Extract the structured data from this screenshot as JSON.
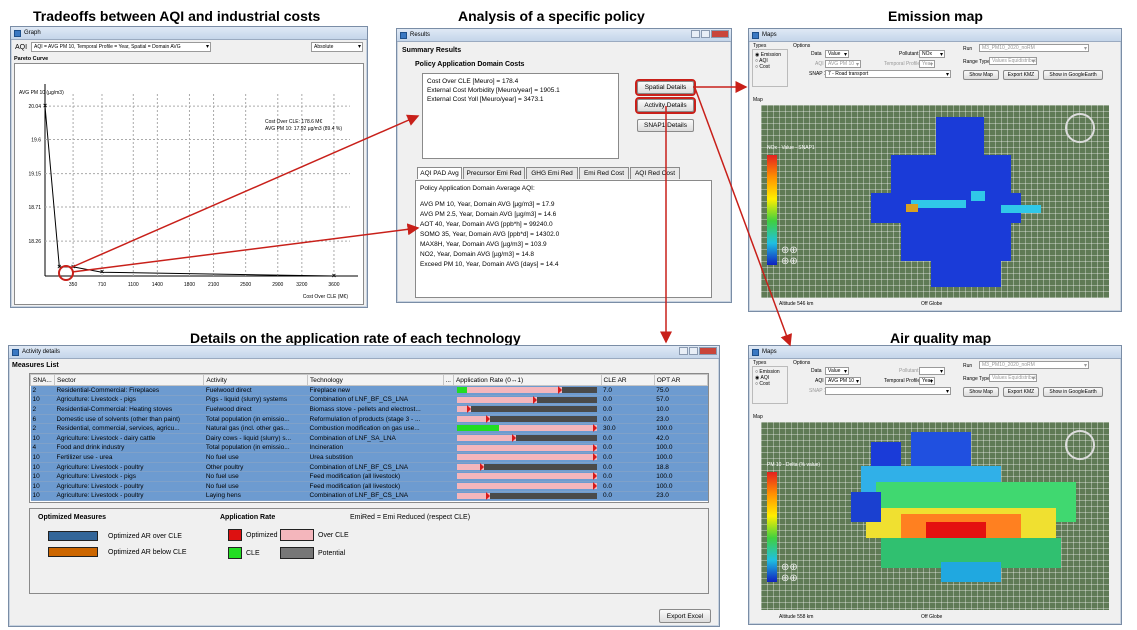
{
  "captions": {
    "tradeoffs": "Tradeoffs between AQI and industrial costs",
    "analysis": "Analysis of a specific policy",
    "emission_map": "Emission map",
    "details": "Details on the application rate of each technology",
    "aq_map": "Air quality map"
  },
  "graph_window": {
    "title": "Graph",
    "aqi_label": "AQI",
    "aqi_select": "AQI = AVG PM 10, Temporal Profile = Year, Spatial = Domain AVG",
    "mode_select": "Absolute",
    "panel_label": "Pareto Curve",
    "annotation_1": "Cost Over CLE: 178.6 M€",
    "annotation_2": "AVG PM 10: 17.92 µg/m3 (89.4 %)"
  },
  "chart_data": {
    "type": "line",
    "title": "",
    "xlabel": "Cost Over CLE (M€)",
    "ylabel": "AVG PM 10 (µg/m3)",
    "x_ticks": [
      "350",
      "710",
      "1100",
      "1400",
      "1800",
      "2100",
      "2500",
      "2900",
      "3200",
      "3600"
    ],
    "y_ticks": [
      "20.04",
      "19.6",
      "19.15",
      "18.71",
      "18.26"
    ],
    "series": [
      {
        "x": [
          0,
          178.6,
          350,
          710,
          3600
        ],
        "y": [
          20.04,
          17.92,
          17.92,
          17.85,
          17.8
        ]
      }
    ],
    "grid": true
  },
  "results_window": {
    "title": "Results",
    "summary_label": "Summary Results",
    "domain_costs_label": "Policy Application Domain Costs",
    "cost_lines": [
      "Cost Over CLE [Meuro] = 178.4",
      "External Cost Morbidity [Meuro/year] = 1905.1",
      "External Cost Yoll [Meuro/year] = 3473.1"
    ],
    "buttons": [
      "Spatial Details",
      "Activity Details",
      "SNAP1 Details"
    ],
    "tabs": [
      "AQI PAD Avg",
      "Precursor Emi Red",
      "GHG Emi Red",
      "Emi Red Cost",
      "AQI Red Cost"
    ],
    "aqi_heading": "Policy Application Domain Average AQI:",
    "aqi_lines": [
      "AVG PM 10, Year, Domain AVG [µg/m3] = 17.9",
      "AVG PM 2.5, Year, Domain AVG [µg/m3] = 14.6",
      "AOT 40, Year, Domain AVG [ppb*h] = 99240.0",
      "SOMO 35, Year, Domain AVG [ppb*d] = 14302.0",
      "MAX8H, Year, Domain AVG [µg/m3] = 103.9",
      "NO2, Year, Domain AVG [µg/m3] = 14.8",
      "Exceed PM 10, Year, Domain AVG [days] = 14.4"
    ]
  },
  "activity_window": {
    "title": "Activity details",
    "measures_label": "Measures List",
    "columns": [
      "SNA...",
      "Sector",
      "Activity",
      "Technology",
      "...",
      "Application Rate (0↔1)",
      "CLE AR",
      "OPT AR"
    ],
    "rows": [
      {
        "snap": "2",
        "sector": "Residential-Commercial: Fireplaces",
        "activity": "Fuelwood direct",
        "tech": "Fireplace new",
        "cle": "7.0",
        "opt": "75.0",
        "cle_frac": 0.07,
        "opt_frac": 0.75
      },
      {
        "snap": "10",
        "sector": "Agriculture: Livestock - pigs",
        "activity": "Pigs - liquid (slurry) systems",
        "tech": "Combination of LNF_BF_CS_LNA",
        "cle": "0.0",
        "opt": "57.0",
        "cle_frac": 0,
        "opt_frac": 0.57
      },
      {
        "snap": "2",
        "sector": "Residential-Commercial: Heating stoves",
        "activity": "Fuelwood direct",
        "tech": "Biomass stove - pellets and electrost...",
        "cle": "0.0",
        "opt": "10.0",
        "cle_frac": 0,
        "opt_frac": 0.1
      },
      {
        "snap": "6",
        "sector": "Domestic use of solvents (other than paint)",
        "activity": "Total population (in emissio...",
        "tech": "Reformulation of products (stage 3 - ...",
        "cle": "0.0",
        "opt": "23.0",
        "cle_frac": 0,
        "opt_frac": 0.23
      },
      {
        "snap": "2",
        "sector": "Residential, commercial, services, agricu...",
        "activity": "Natural gas (incl. other gas...",
        "tech": "Combustion modification on gas use...",
        "cle": "30.0",
        "opt": "100.0",
        "cle_frac": 0.3,
        "opt_frac": 1.0
      },
      {
        "snap": "10",
        "sector": "Agriculture: Livestock - dairy cattle",
        "activity": "Dairy cows - liquid (slurry) s...",
        "tech": "Combination of LNF_SA_LNA",
        "cle": "0.0",
        "opt": "42.0",
        "cle_frac": 0,
        "opt_frac": 0.42
      },
      {
        "snap": "4",
        "sector": "Food and drink industry",
        "activity": "Total population (in emissio...",
        "tech": "Incineration",
        "cle": "0.0",
        "opt": "100.0",
        "cle_frac": 0,
        "opt_frac": 1.0
      },
      {
        "snap": "10",
        "sector": "Fertilizer use - urea",
        "activity": "No fuel use",
        "tech": "Urea substition",
        "cle": "0.0",
        "opt": "100.0",
        "cle_frac": 0,
        "opt_frac": 1.0
      },
      {
        "snap": "10",
        "sector": "Agriculture: Livestock - poultry",
        "activity": "Other poultry",
        "tech": "Combination of LNF_BF_CS_LNA",
        "cle": "0.0",
        "opt": "18.8",
        "cle_frac": 0,
        "opt_frac": 0.188
      },
      {
        "snap": "10",
        "sector": "Agriculture: Livestock - pigs",
        "activity": "No fuel use",
        "tech": "Feed modification (all livestock)",
        "cle": "0.0",
        "opt": "100.0",
        "cle_frac": 0,
        "opt_frac": 1.0
      },
      {
        "snap": "10",
        "sector": "Agriculture: Livestock - poultry",
        "activity": "No fuel use",
        "tech": "Feed modification (all livestock)",
        "cle": "0.0",
        "opt": "100.0",
        "cle_frac": 0,
        "opt_frac": 1.0
      },
      {
        "snap": "10",
        "sector": "Agriculture: Livestock - poultry",
        "activity": "Laying hens",
        "tech": "Combination of LNF_BF_CS_LNA",
        "cle": "0.0",
        "opt": "23.0",
        "cle_frac": 0,
        "opt_frac": 0.23
      }
    ],
    "legend": {
      "optimized_title": "Optimized Measures",
      "over_label": "Optimized AR over CLE",
      "below_label": "Optimized AR below CLE",
      "rate_title": "Application Rate",
      "optimized": "Optimized",
      "over_cle": "Over CLE",
      "cle": "CLE",
      "potential": "Potential",
      "emired_note": "EmiRed = Emi Reduced (respect CLE)"
    },
    "export_button": "Export Excel"
  },
  "maps_common": {
    "title": "Maps",
    "types_label": "Types",
    "type_options": [
      "Emission",
      "AQI",
      "Cost"
    ],
    "options_label": "Options",
    "data_label": "Data",
    "data_value": "Value",
    "pollutant_label": "Pollutant",
    "aqi_label": "AQI",
    "aqi_value": "AVG PM 10",
    "temporal_label": "Temporal Profile",
    "temporal_value": "Year",
    "snap_label": "SNAP 1",
    "run_label": "Run",
    "run_value": "M3_PM10_2020_noRM",
    "range_label": "Range Type",
    "range_value": "Values Equidistributed",
    "show_map": "Show Map",
    "export_kmz": "Export KMZ",
    "show_ge": "Show in GoogleEarth",
    "map_label": "Map",
    "off_globe": "Off Globe"
  },
  "emission_map": {
    "pollutant_value": "NOx",
    "snap_value": "7 - Road transport",
    "scale_title": "NOx - Value - SNAP1",
    "altitude": "Altitude   546 km",
    "selected_type": 0
  },
  "aq_map": {
    "pollutant_value": "",
    "snap_value": "",
    "scale_title": "PM 10 - Delta (% value)",
    "altitude": "Altitude   558 km",
    "selected_type": 1
  },
  "colors": {
    "red_arrow": "#c8201a",
    "table_blue": "#6d9bd0",
    "legend_over": "#336699",
    "legend_below": "#cc6600"
  }
}
